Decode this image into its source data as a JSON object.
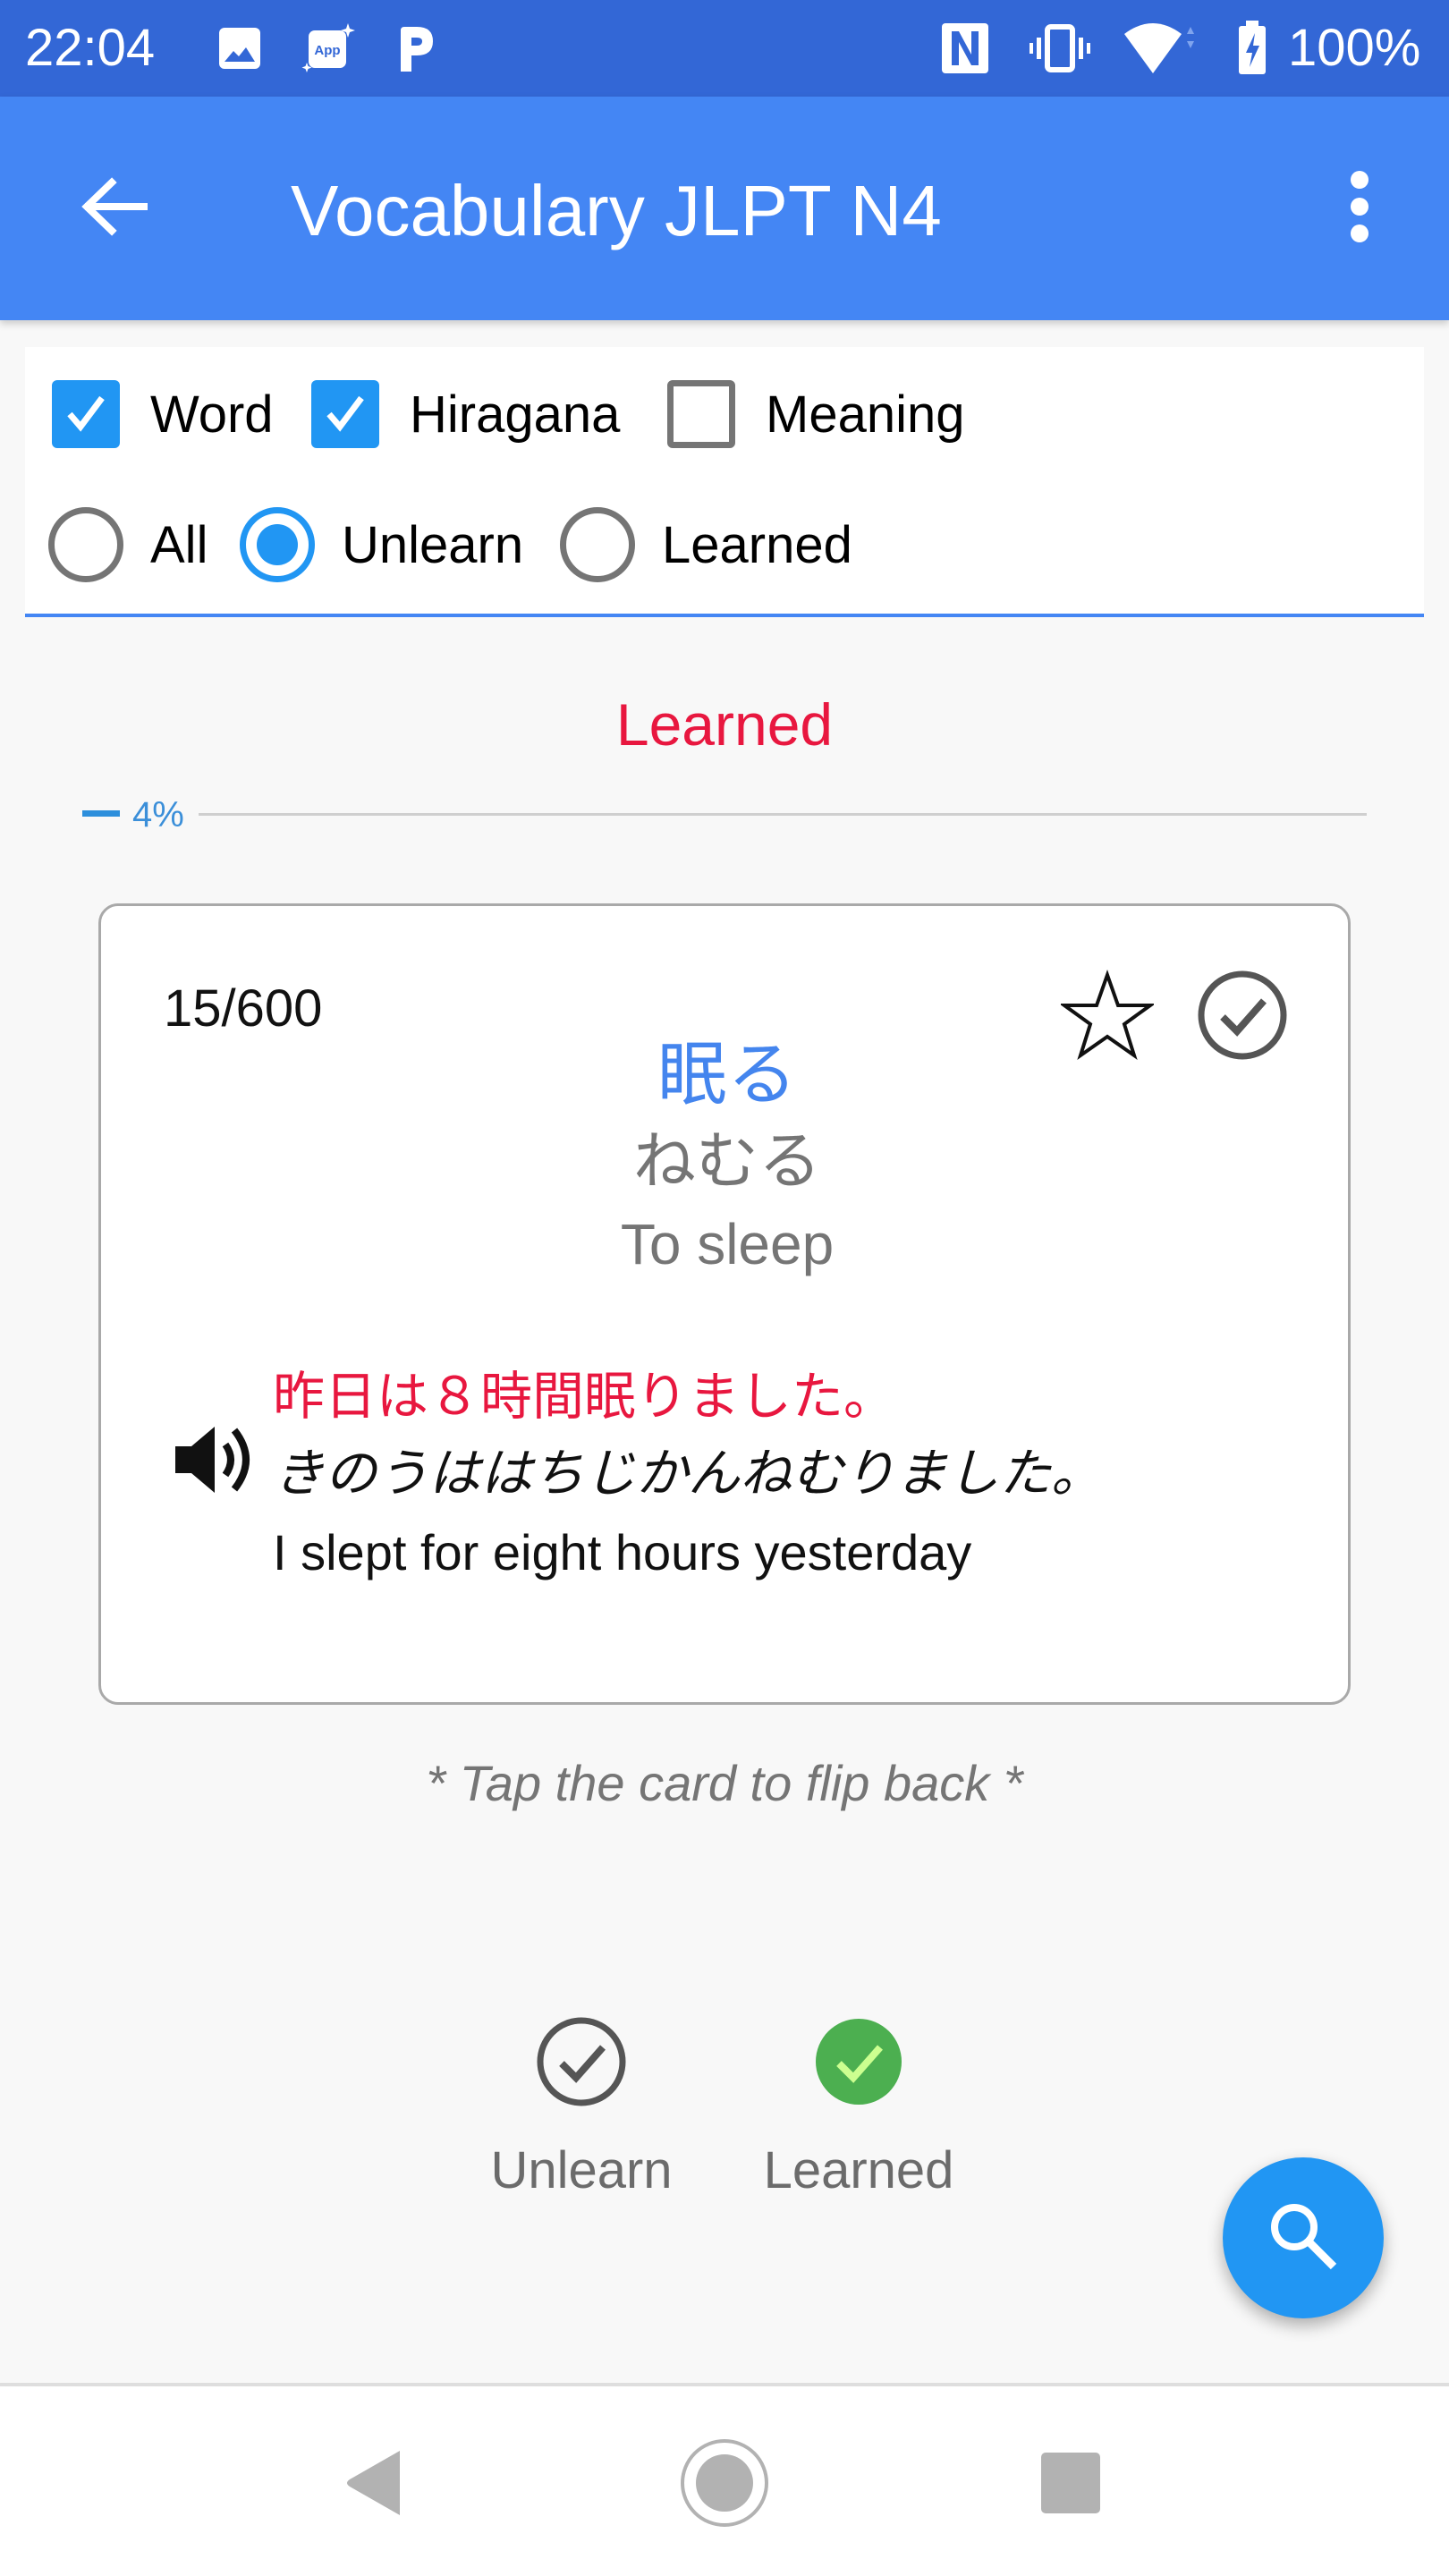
{
  "status_bar": {
    "time": "22:04",
    "left_icons": [
      "gallery-icon",
      "app-notification-icon",
      "p-app-icon"
    ],
    "right_icons": [
      "nfc-icon",
      "vibrate-icon",
      "wifi-icon",
      "battery-charging-icon"
    ],
    "battery": "100%"
  },
  "app_bar": {
    "title": "Vocabulary JLPT N4",
    "back_icon": "arrow-back-icon",
    "menu_icon": "more-vertical-icon"
  },
  "filters": {
    "checkboxes": [
      {
        "label": "Word",
        "checked": true
      },
      {
        "label": "Hiragana",
        "checked": true
      },
      {
        "label": "Meaning",
        "checked": false
      }
    ],
    "radios": [
      {
        "label": "All",
        "selected": false
      },
      {
        "label": "Unlearn",
        "selected": true
      },
      {
        "label": "Learned",
        "selected": false
      }
    ]
  },
  "status_heading": "Learned",
  "progress": {
    "percent": 4,
    "label": "4%"
  },
  "card": {
    "counter": "15/600",
    "word": "眠る",
    "reading": "ねむる",
    "meaning": "To sleep",
    "example": {
      "japanese": "昨日は８時間眠りました。",
      "kana": "きのうははちじかんねむりました。",
      "english": "I slept for eight hours yesterday"
    },
    "favorite": false,
    "learned_mark": false
  },
  "hint": "* Tap the card to flip back *",
  "toggles": [
    {
      "label": "Unlearn",
      "icon": "check-circle-outline-icon",
      "active": false
    },
    {
      "label": "Learned",
      "icon": "check-circle-filled-icon",
      "active": true
    }
  ],
  "colors": {
    "status_bar": "#3367d6",
    "app_bar": "#4486f4",
    "accent": "#2196f3",
    "heading_red": "#e8173f",
    "word_blue": "#4485ee",
    "learned_green": "#4caf50"
  },
  "fab": {
    "icon": "search-icon"
  },
  "nav_bar": {
    "buttons": [
      "back",
      "home",
      "recents"
    ]
  }
}
